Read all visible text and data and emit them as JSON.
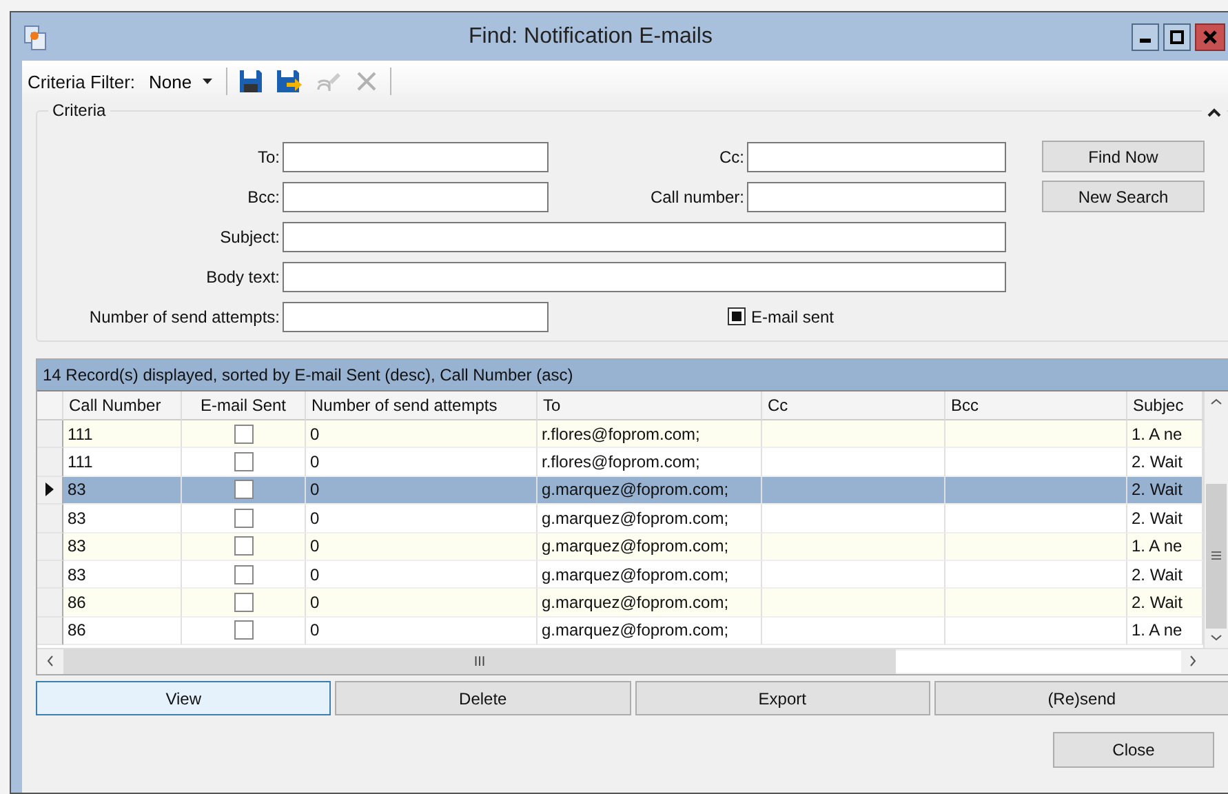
{
  "window": {
    "title": "Find: Notification E-mails"
  },
  "toolbar": {
    "filter_label": "Criteria Filter:",
    "filter_value": "None",
    "buttons": [
      {
        "kind": "save",
        "disabled": false
      },
      {
        "kind": "save_as",
        "disabled": false
      },
      {
        "kind": "clear",
        "disabled": true
      },
      {
        "kind": "delete",
        "disabled": true
      }
    ]
  },
  "criteria": {
    "title": "Criteria",
    "expanded": true,
    "fields": [
      {
        "label": "To:",
        "kind": "short"
      },
      {
        "label": "Cc:",
        "kind": "short"
      },
      {
        "label": "Bcc:",
        "kind": "short"
      },
      {
        "label": "Call number:",
        "kind": "short"
      },
      {
        "label": "Subject:",
        "kind": "wide"
      },
      {
        "label": "Body text:",
        "kind": "wide"
      },
      {
        "label": "Number of send attempts:",
        "kind": "short"
      }
    ],
    "email_sent_filter": {
      "label": "E-mail sent",
      "indeterminate": true
    },
    "buttons": [
      "Find Now",
      "New Search"
    ]
  },
  "results": {
    "summary": "14 Record(s) displayed, sorted by E-mail Sent (desc), Call Number (asc)",
    "columns": [
      "Call Number",
      "E-mail Sent",
      "Number of send attempts",
      "To",
      "Cc",
      "Bcc",
      "Subjec"
    ],
    "rows": [
      {
        "call_number": "111",
        "email_sent": false,
        "attempts": "0",
        "to": "r.flores@foprom.com;",
        "subject": "1. A ne",
        "selected": false
      },
      {
        "call_number": "111",
        "email_sent": false,
        "attempts": "0",
        "to": "r.flores@foprom.com;",
        "subject": "2. Wait",
        "selected": false
      },
      {
        "call_number": "83",
        "email_sent": false,
        "attempts": "0",
        "to": "g.marquez@foprom.com;",
        "subject": "2. Wait",
        "selected": true
      },
      {
        "call_number": "83",
        "email_sent": false,
        "attempts": "0",
        "to": "g.marquez@foprom.com;",
        "subject": "2. Wait",
        "selected": false
      },
      {
        "call_number": "83",
        "email_sent": false,
        "attempts": "0",
        "to": "g.marquez@foprom.com;",
        "subject": "1. A ne",
        "selected": false
      },
      {
        "call_number": "83",
        "email_sent": false,
        "attempts": "0",
        "to": "g.marquez@foprom.com;",
        "subject": "2. Wait",
        "selected": false
      },
      {
        "call_number": "86",
        "email_sent": false,
        "attempts": "0",
        "to": "g.marquez@foprom.com;",
        "subject": "2. Wait",
        "selected": false
      },
      {
        "call_number": "86",
        "email_sent": false,
        "attempts": "0",
        "to": "g.marquez@foprom.com;",
        "subject": "1. A ne",
        "selected": false
      }
    ],
    "grip": "III"
  },
  "actions": [
    {
      "label": "View",
      "focused": true
    },
    {
      "label": "Delete",
      "focused": false
    },
    {
      "label": "Export",
      "focused": false
    },
    {
      "label": "(Re)send",
      "focused": false
    }
  ],
  "close_button": "Close"
}
